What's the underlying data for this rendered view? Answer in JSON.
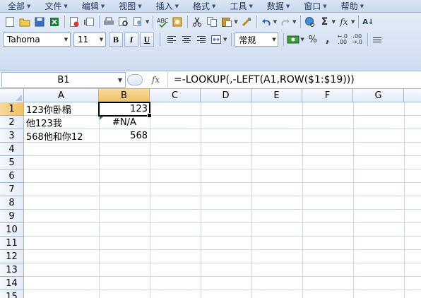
{
  "menu": [
    {
      "label": "全部",
      "icon": "all-icon"
    },
    {
      "label": "文件",
      "icon": "file-icon"
    },
    {
      "label": "编辑",
      "icon": "edit-icon"
    },
    {
      "label": "视图",
      "icon": "view-icon"
    },
    {
      "label": "插入",
      "icon": "insert-icon"
    },
    {
      "label": "格式",
      "icon": "format-icon"
    },
    {
      "label": "工具",
      "icon": "tools-icon"
    },
    {
      "label": "数据",
      "icon": "data-icon"
    },
    {
      "label": "窗口",
      "icon": "window-icon"
    },
    {
      "label": "帮助",
      "icon": "help-icon"
    }
  ],
  "toolbar": {
    "font": "Tahoma",
    "font_size": "11",
    "bold": "B",
    "italic": "I",
    "underline": "U",
    "number_format": "常规",
    "percent": "%",
    "comma": ","
  },
  "formula_bar": {
    "name_box": "B1",
    "fx": "fx",
    "formula": "=-LOOKUP(,-LEFT(A1,ROW($1:$19)))"
  },
  "grid": {
    "columns": [
      "A",
      "B",
      "C",
      "D",
      "E",
      "F",
      "G"
    ],
    "rows": [
      "1",
      "2",
      "3",
      "4",
      "5",
      "6",
      "7",
      "8",
      "9",
      "10",
      "11",
      "12",
      "13",
      "14",
      "15"
    ],
    "cells": {
      "A1": "123你卧榻",
      "B1": "123",
      "A2": "他123我",
      "B2": "#N/A",
      "A3": "568他和你12",
      "B3": "568"
    },
    "active_cell": "B1"
  }
}
